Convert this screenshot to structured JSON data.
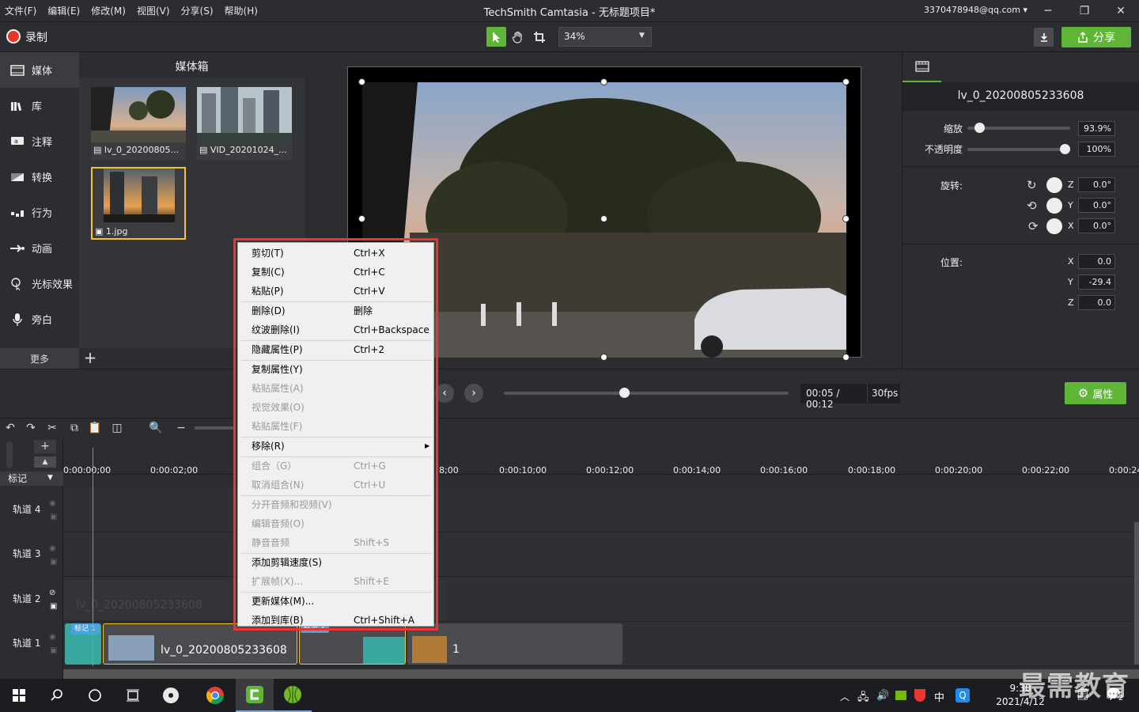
{
  "window": {
    "title": "TechSmith Camtasia - 无标题项目*",
    "account": "3370478948@qq.com",
    "menu": [
      "文件(F)",
      "编辑(E)",
      "修改(M)",
      "视图(V)",
      "分享(S)",
      "帮助(H)"
    ]
  },
  "toolbar": {
    "record_label": "录制",
    "zoom": "34%",
    "share_label": "分享"
  },
  "leftnav": {
    "items": [
      "媒体",
      "库",
      "注释",
      "转换",
      "行为",
      "动画",
      "光标效果",
      "旁白"
    ],
    "more_label": "更多"
  },
  "bin": {
    "title": "媒体箱",
    "items": [
      {
        "name": "lv_0_20200805..."
      },
      {
        "name": "VID_20201024_..."
      },
      {
        "name": "1.jpg"
      }
    ]
  },
  "properties": {
    "clip_name": "lv_0_20200805233608",
    "scale_label": "缩放",
    "scale_value": "93.9%",
    "scale_fraction": 0.08,
    "opacity_label": "不透明度",
    "opacity_value": "100%",
    "opacity_fraction": 1.0,
    "rotation_label": "旋转:",
    "rotation": [
      {
        "axis": "Z",
        "value": "0.0°"
      },
      {
        "axis": "Y",
        "value": "0.0°"
      },
      {
        "axis": "X",
        "value": "0.0°"
      }
    ],
    "position_label": "位置:",
    "position": [
      {
        "axis": "X",
        "value": "0.0"
      },
      {
        "axis": "Y",
        "value": "-29.4"
      },
      {
        "axis": "Z",
        "value": "0.0"
      }
    ],
    "button_label": "属性"
  },
  "playback": {
    "time": "00:05 / 00:12",
    "fps": "30fps",
    "progress_fraction": 0.42
  },
  "timeline": {
    "marker_label": "标记",
    "ticks": [
      "0:00:00;00",
      "0:00:02;00",
      "8;00",
      "0:00:10;00",
      "0:00:12;00",
      "0:00:14;00",
      "0:00:16;00",
      "0:00:18;00",
      "0:00:20;00",
      "0:00:22;00",
      "0:00:24"
    ],
    "tracks": [
      "轨道 4",
      "轨道 3",
      "轨道 2",
      "轨道 1"
    ],
    "ghost_clip_label": "lv_0_20200805233608",
    "clips": [
      {
        "label": "lv_0_20200805233608",
        "tag": "标记 1"
      },
      {
        "label": "",
        "tag": "标记 2"
      },
      {
        "label": "1",
        "tag": ""
      }
    ]
  },
  "context_menu": {
    "items": [
      {
        "label": "剪切(T)",
        "shortcut": "Ctrl+X",
        "enabled": true
      },
      {
        "label": "复制(C)",
        "shortcut": "Ctrl+C",
        "enabled": true
      },
      {
        "label": "粘贴(P)",
        "shortcut": "Ctrl+V",
        "enabled": true
      },
      {
        "label": "删除(D)",
        "shortcut": "删除",
        "enabled": true
      },
      {
        "label": "纹波删除(I)",
        "shortcut": "Ctrl+Backspace",
        "enabled": true
      },
      {
        "label": "隐藏属性(P)",
        "shortcut": "Ctrl+2",
        "enabled": true
      },
      {
        "label": "复制属性(Y)",
        "shortcut": "",
        "enabled": true
      },
      {
        "label": "粘贴属性(A)",
        "shortcut": "",
        "enabled": false
      },
      {
        "label": "视觉效果(O)",
        "shortcut": "",
        "enabled": false
      },
      {
        "label": "粘贴属性(F)",
        "shortcut": "",
        "enabled": false
      },
      {
        "label": "移除(R)",
        "shortcut": "",
        "enabled": true,
        "submenu": true
      },
      {
        "label": "组合（G）",
        "shortcut": "Ctrl+G",
        "enabled": false
      },
      {
        "label": "取消组合(N)",
        "shortcut": "Ctrl+U",
        "enabled": false
      },
      {
        "label": "分开音频和视频(V)",
        "shortcut": "",
        "enabled": false
      },
      {
        "label": "编辑音频(O)",
        "shortcut": "",
        "enabled": false
      },
      {
        "label": "静音音频",
        "shortcut": "Shift+S",
        "enabled": false
      },
      {
        "label": "添加剪辑速度(S)",
        "shortcut": "",
        "enabled": true
      },
      {
        "label": "扩展帧(X)...",
        "shortcut": "Shift+E",
        "enabled": false
      },
      {
        "label": "更新媒体(M)...",
        "shortcut": "",
        "enabled": true
      },
      {
        "label": "添加到库(B)",
        "shortcut": "Ctrl+Shift+A",
        "enabled": true
      }
    ]
  },
  "taskbar": {
    "time": "9:30",
    "date": "2021/4/12",
    "ime": "中",
    "notifications": "2"
  },
  "watermark": "最需教育"
}
